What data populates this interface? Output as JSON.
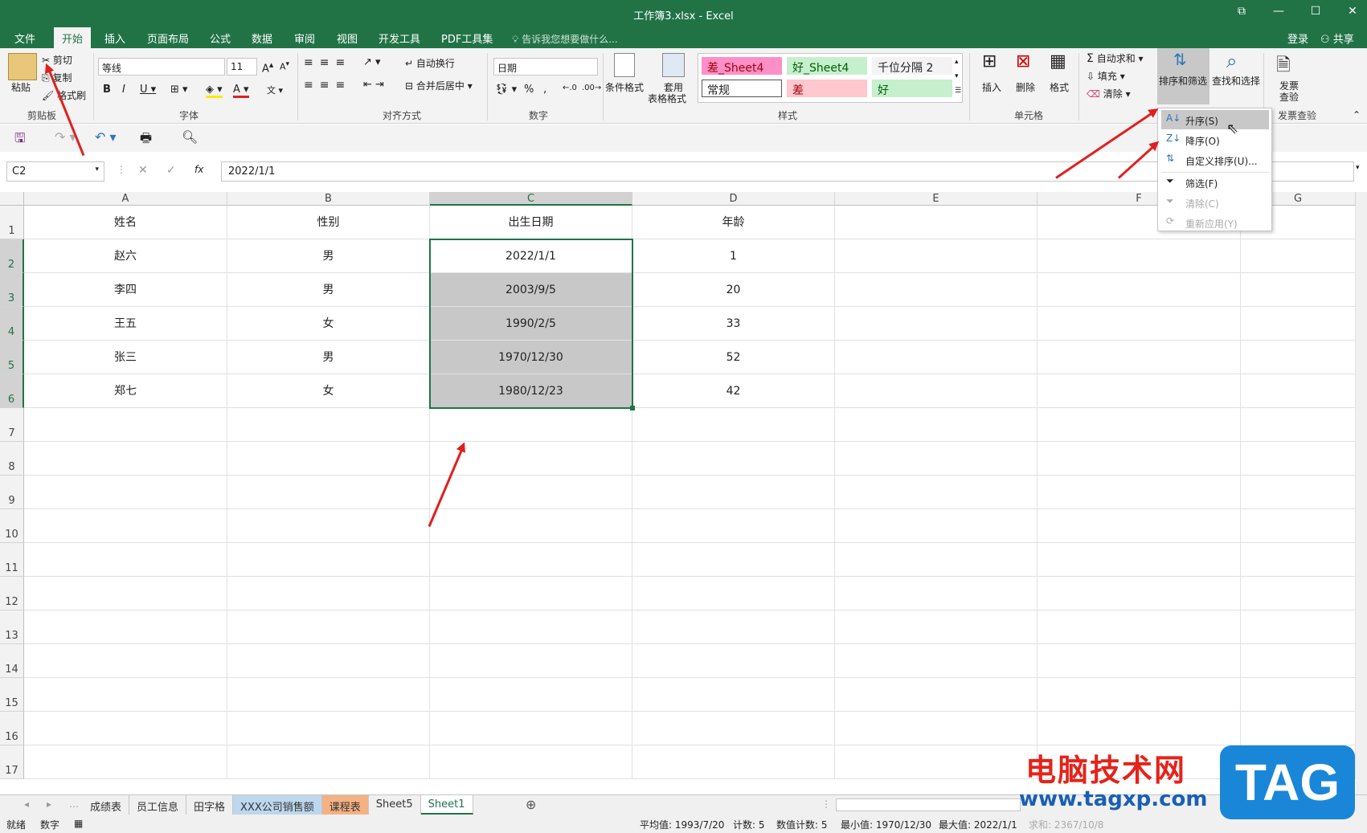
{
  "window": {
    "title": "工作簿3.xlsx - Excel",
    "login": "登录",
    "share": "共享"
  },
  "tabs": [
    "文件",
    "开始",
    "插入",
    "页面布局",
    "公式",
    "数据",
    "审阅",
    "视图",
    "开发工具",
    "PDF工具集"
  ],
  "tell_me": "告诉我您想要做什么...",
  "ribbon": {
    "clipboard": {
      "paste": "粘贴",
      "cut": "剪切",
      "copy": "复制",
      "format_painter": "格式刷",
      "label": "剪贴板"
    },
    "font": {
      "name": "等线",
      "size": "11",
      "label": "字体"
    },
    "alignment": {
      "wrap": "自动换行",
      "merge": "合并后居中",
      "label": "对齐方式"
    },
    "number": {
      "format": "日期",
      "percent": "%",
      "comma": ",",
      "label": "数字"
    },
    "styles": {
      "conditional": "条件格式",
      "table_format_1": "套用",
      "table_format_2": "表格格式",
      "cells": [
        {
          "text": "差_Sheet4",
          "bg": "#ff8fc8",
          "color": "#9c0006"
        },
        {
          "text": "好_Sheet4",
          "bg": "#c6efce",
          "color": "#006100"
        },
        {
          "text": "千位分隔 2",
          "bg": "#f3f3f3",
          "color": "#222"
        },
        {
          "text": "常规",
          "bg": "#ffffff",
          "color": "#222"
        },
        {
          "text": "差",
          "bg": "#ffc7ce",
          "color": "#9c0006"
        },
        {
          "text": "好",
          "bg": "#c6efce",
          "color": "#006100"
        }
      ],
      "label": "样式"
    },
    "cells_group": {
      "insert": "插入",
      "delete": "删除",
      "format": "格式",
      "label": "单元格"
    },
    "editing": {
      "autosum": "自动求和",
      "fill": "填充",
      "clear": "清除",
      "sort_filter": "排序和筛选",
      "find_select": "查找和选择"
    },
    "invoice": {
      "line1": "发票",
      "line2": "查验",
      "label": "发票查验"
    }
  },
  "formula_bar": {
    "name_box": "C2",
    "fx": "fx",
    "value": "2022/1/1"
  },
  "columns": [
    "A",
    "B",
    "C",
    "D",
    "E",
    "F",
    "G"
  ],
  "rows": [
    "1",
    "2",
    "3",
    "4",
    "5",
    "6",
    "7",
    "8",
    "9",
    "10",
    "11",
    "12",
    "13",
    "14",
    "15",
    "16",
    "17"
  ],
  "table": [
    [
      "姓名",
      "性别",
      "出生日期",
      "年龄"
    ],
    [
      "赵六",
      "男",
      "2022/1/1",
      "1"
    ],
    [
      "李四",
      "男",
      "2003/9/5",
      "20"
    ],
    [
      "王五",
      "女",
      "1990/2/5",
      "33"
    ],
    [
      "张三",
      "男",
      "1970/12/30",
      "52"
    ],
    [
      "郑七",
      "女",
      "1980/12/23",
      "42"
    ]
  ],
  "dropdown": [
    "升序(S)",
    "降序(O)",
    "自定义排序(U)...",
    "筛选(F)",
    "清除(C)",
    "重新应用(Y)"
  ],
  "sheet_tabs": [
    {
      "name": "成绩表",
      "bg": "#f0f0f0"
    },
    {
      "name": "员工信息",
      "bg": "#f0f0f0"
    },
    {
      "name": "田字格",
      "bg": "#f0f0f0"
    },
    {
      "name": "XXX公司销售额",
      "bg": "#bdd7ee"
    },
    {
      "name": "课程表",
      "bg": "#f4b183"
    },
    {
      "name": "Sheet5",
      "bg": "#f0f0f0"
    },
    {
      "name": "Sheet1",
      "bg": "#ffffff"
    }
  ],
  "status": {
    "ready": "就绪",
    "mode": "数字",
    "average": "平均值: 1993/7/20",
    "count": "计数: 5",
    "num_count": "数值计数: 5",
    "min": "最小值: 1970/12/30",
    "max": "最大值: 2022/1/1",
    "sum": "求和: 2367/10/8"
  },
  "watermark": {
    "line1": "电脑技术网",
    "line2": "www.tagxp.com",
    "tag": "TAG"
  },
  "colors": {
    "excel_green": "#217346",
    "arrow_red": "#e02020",
    "selection_gray": "#c8c8c8"
  }
}
